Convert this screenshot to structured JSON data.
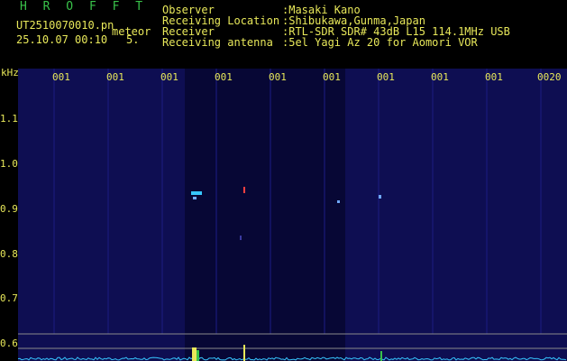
{
  "header": {
    "app_title": "H R O F F T",
    "file_name": "UT2510070010.pn",
    "meteor_label": "meteor",
    "datetime": "25.10.07 00:10",
    "count": "5.",
    "info": [
      {
        "label": "Observer",
        "value": ":Masaki Kano"
      },
      {
        "label": "Receiving Location",
        "value": ":Shibukawa,Gunma,Japan"
      },
      {
        "label": "Receiver",
        "value": ":RTL-SDR SDR# 43dB L15 114.1MHz USB"
      },
      {
        "label": "Receiving antenna",
        "value": ":5el Yagi Az 20 for Aomori VOR"
      }
    ]
  },
  "spectrogram": {
    "unit_label": "kHz",
    "y_ticks": [
      "1.1",
      "1.0",
      "0.9",
      "0.8",
      "0.7",
      "0.6"
    ],
    "x_ticks": [
      "001",
      "001",
      "001",
      "001",
      "001",
      "001",
      "001",
      "001",
      "001",
      "0020"
    ],
    "colors": {
      "background": "#0d0d4a",
      "text": "#e8e85a",
      "title": "#39c24a",
      "trace": "#37c6ff",
      "echo": "#6fa8ff"
    }
  }
}
